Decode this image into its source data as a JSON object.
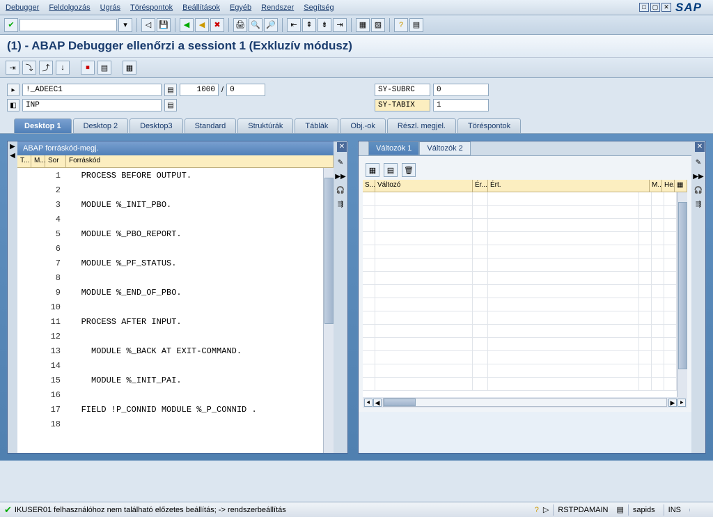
{
  "menu": {
    "debugger": "Debugger",
    "processing": "Feldolgozás",
    "goto": "Ugrás",
    "breakpoints": "Töréspontok",
    "settings": "Beállítások",
    "other": "Egyéb",
    "system": "Rendszer",
    "help": "Segítség"
  },
  "window_title": "(1) - ABAP Debugger ellenőrzi a sessiont 1 (Exkluzív módusz)",
  "fields": {
    "program_value": "!_ADEEC1",
    "count1": "1000",
    "count_sep": "/",
    "count2": "0",
    "event_value": "INP",
    "sy_subrc_label": "SY-SUBRC",
    "sy_subrc_value": "0",
    "sy_tabix_label": "SY-TABIX",
    "sy_tabix_value": "1"
  },
  "tabs": {
    "desktop1": "Desktop 1",
    "desktop2": "Desktop 2",
    "desktop3": "Desktop3",
    "standard": "Standard",
    "structures": "Struktúrák",
    "tables": "Táblák",
    "objects": "Obj.-ok",
    "detail": "Részl. megjel.",
    "breakpoints": "Töréspontok"
  },
  "source_panel": {
    "title": "ABAP forráskód-megj.",
    "col_t": "T...",
    "col_m": "M...",
    "col_sor": "Sor",
    "col_code": "Forráskód"
  },
  "code": [
    {
      "n": 1,
      "t": "   PROCESS BEFORE OUTPUT."
    },
    {
      "n": 2,
      "t": ""
    },
    {
      "n": 3,
      "t": "   MODULE %_INIT_PBO."
    },
    {
      "n": 4,
      "t": ""
    },
    {
      "n": 5,
      "t": "   MODULE %_PBO_REPORT."
    },
    {
      "n": 6,
      "t": ""
    },
    {
      "n": 7,
      "t": "   MODULE %_PF_STATUS."
    },
    {
      "n": 8,
      "t": ""
    },
    {
      "n": 9,
      "t": "   MODULE %_END_OF_PBO."
    },
    {
      "n": 10,
      "t": ""
    },
    {
      "n": 11,
      "t": "   PROCESS AFTER INPUT."
    },
    {
      "n": 12,
      "t": ""
    },
    {
      "n": 13,
      "t": "     MODULE %_BACK AT EXIT-COMMAND."
    },
    {
      "n": 14,
      "t": ""
    },
    {
      "n": 15,
      "t": "     MODULE %_INIT_PAI."
    },
    {
      "n": 16,
      "t": ""
    },
    {
      "n": 17,
      "t": "   FIELD !P_CONNID MODULE %_P_CONNID ."
    },
    {
      "n": 18,
      "t": ""
    }
  ],
  "var_panel": {
    "tab1": "Változók 1",
    "tab2": "Változók 2",
    "col_s": "S...",
    "col_var": "Változó",
    "col_e1": "Ér...",
    "col_ert": "Ért.",
    "col_m": "M...",
    "col_h": "He..."
  },
  "status": {
    "message": "IKUSER01 felhasználóhoz nem található előzetes beállítás; -> rendszerbeállítás",
    "program": "RSTPDAMAIN",
    "user": "sapids",
    "mode": "INS"
  }
}
